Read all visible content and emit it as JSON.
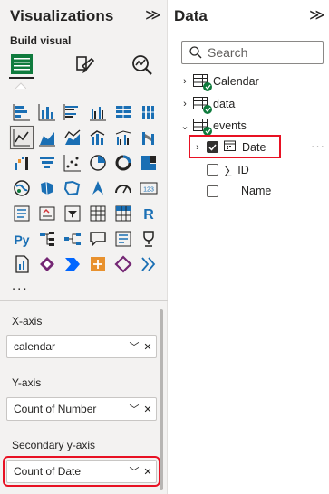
{
  "visualizations": {
    "title": "Visualizations",
    "build_visual_label": "Build visual",
    "more_label": "...",
    "tile_icons": [
      "stacked-bar-chart-icon",
      "stacked-column-chart-icon",
      "clustered-bar-chart-icon",
      "clustered-column-chart-icon",
      "100-stacked-bar-chart-icon",
      "100-stacked-column-chart-icon",
      "line-chart-icon",
      "area-chart-icon",
      "stacked-area-chart-icon",
      "line-stacked-column-chart-icon",
      "line-clustered-column-chart-icon",
      "ribbon-chart-icon",
      "waterfall-chart-icon",
      "funnel-chart-icon",
      "scatter-chart-icon",
      "pie-chart-icon",
      "donut-chart-icon",
      "treemap-icon",
      "map-icon",
      "filled-map-icon",
      "shape-map-icon",
      "azure-map-icon",
      "gauge-icon",
      "card-icon",
      "multi-row-card-icon",
      "kpi-icon",
      "slicer-icon",
      "table-icon",
      "matrix-icon",
      "r-visual-icon",
      "python-visual-icon",
      "key-influencers-icon",
      "decomposition-tree-icon",
      "qa-icon",
      "narrative-icon",
      "goals-icon",
      "paginated-report-icon",
      "power-apps-icon",
      "power-automate-icon",
      "arcgis-icon",
      "diamond-visual-icon",
      "get-more-visuals-icon"
    ],
    "selected_tile": "line-chart-icon",
    "wells": [
      {
        "label": "X-axis",
        "value": "calendar"
      },
      {
        "label": "Y-axis",
        "value": "Count of Number"
      },
      {
        "label": "Secondary y-axis",
        "value": "Count of Date"
      }
    ]
  },
  "data_pane": {
    "title": "Data",
    "search_placeholder": "Search",
    "tables": [
      "Calendar",
      "data",
      "events"
    ],
    "fields": [
      {
        "name": "Date",
        "checked": true
      },
      {
        "name": "ID",
        "checked": false
      },
      {
        "name": "Name",
        "checked": false
      }
    ]
  },
  "colors": {
    "accent_red": "#e81123",
    "badge_green": "#0f7b3d",
    "icon_blue": "#1a6fb4",
    "icon_orange": "#e8912d"
  }
}
